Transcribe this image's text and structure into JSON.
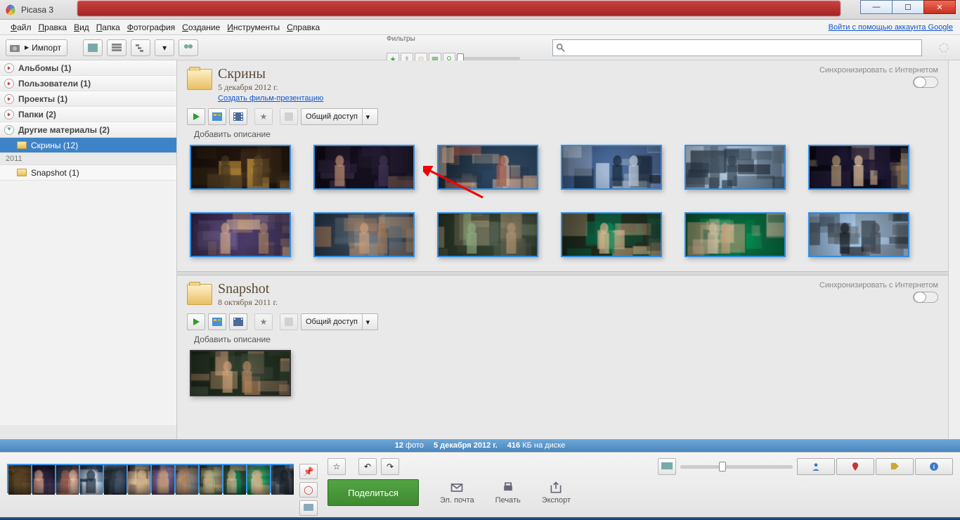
{
  "title": "Picasa 3",
  "menu": [
    "Файл",
    "Правка",
    "Вид",
    "Папка",
    "Фотография",
    "Создание",
    "Инструменты",
    "Справка"
  ],
  "google_link": "Войти с помощью аккаунта Google",
  "toolbar": {
    "import": "Импорт",
    "filters_label": "Фильтры"
  },
  "search": {
    "placeholder": ""
  },
  "sidebar": {
    "cats": [
      {
        "label": "Альбомы (1)"
      },
      {
        "label": "Пользователи (1)"
      },
      {
        "label": "Проекты (1)"
      },
      {
        "label": "Папки (2)"
      },
      {
        "label": "Другие материалы (2)",
        "open": true
      }
    ],
    "selected": "Скрины (12)",
    "year": "2011",
    "child": "Snapshot (1)"
  },
  "folder1": {
    "title": "Скрины",
    "date": "5 декабря 2012 г.",
    "createlink": "Создать фильм-презентацию",
    "share": "Общий доступ",
    "sync": "Синхронизировать с Интернетом",
    "desc": "Добавить описание",
    "thumbs": 12
  },
  "folder2": {
    "title": "Snapshot",
    "date": "8 октября 2011 г.",
    "share": "Общий доступ",
    "sync": "Синхронизировать с Интернетом",
    "desc": "Добавить описание",
    "thumbs": 1
  },
  "status": {
    "count": "12",
    "count_label": "фото",
    "date": "5 декабря 2012 г.",
    "size": "416",
    "size_label": "КБ на диске"
  },
  "bottom": {
    "share": "Поделиться",
    "email": "Эл. почта",
    "print": "Печать",
    "export": "Экспорт"
  },
  "thumb_palettes": [
    [
      "#1a120b",
      "#2a1a10",
      "#3a2818",
      "#4a3820",
      "#5a4428",
      "#c89840"
    ],
    [
      "#0e0a14",
      "#1a1426",
      "#2a2038",
      "#483a5c",
      "#d8a080",
      "#201830"
    ],
    [
      "#1a2a3a",
      "#3a5a7a",
      "#c89070",
      "#e8c8b0",
      "#a86050",
      "#283848"
    ],
    [
      "#3a5a8a",
      "#5a7aaa",
      "#b8c8d8",
      "#d8e8f8",
      "#182838",
      "#486898"
    ],
    [
      "#c8d8e8",
      "#98b8d8",
      "#182028",
      "#304050",
      "#485868",
      "#687888"
    ],
    [
      "#0a0812",
      "#141024",
      "#1e1836",
      "#e8c8a0",
      "#c8a880",
      "#282040"
    ],
    [
      "#382850",
      "#584878",
      "#786898",
      "#d8b090",
      "#b89070",
      "#483860"
    ],
    [
      "#283848",
      "#485868",
      "#687888",
      "#c8a080",
      "#a88060",
      "#384858"
    ],
    [
      "#2a3828",
      "#3a4838",
      "#4a5848",
      "#9ab888",
      "#c8a880",
      "#5a6858"
    ],
    [
      "#1a2818",
      "#2a3828",
      "#0a6848",
      "#088858",
      "#d8b890",
      "#384838"
    ],
    [
      "#0a5838",
      "#087848",
      "#089858",
      "#e8d0b0",
      "#c8a880",
      "#186848"
    ],
    [
      "#98b8d8",
      "#b8d8f8",
      "#283038",
      "#485058",
      "#182028",
      "#687078"
    ],
    [
      "#1a2818",
      "#2a3828",
      "#3a4838",
      "#d8a880",
      "#b88860",
      "#4a5848"
    ]
  ]
}
